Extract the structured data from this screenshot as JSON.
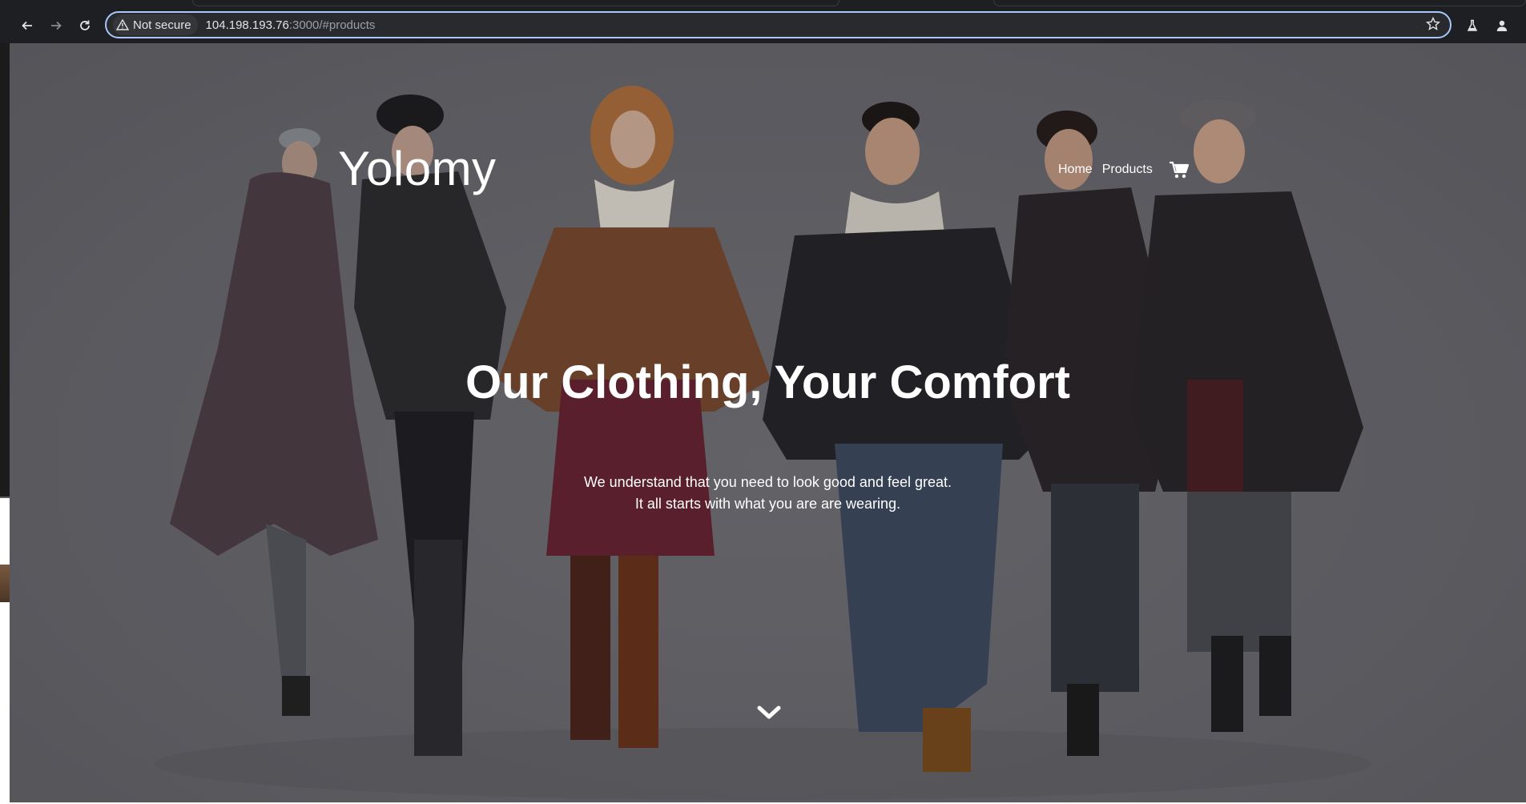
{
  "browser": {
    "security_label": "Not secure",
    "url_host": "104.198.193.76",
    "url_rest": ":3000/#products",
    "icons": [
      "back-icon",
      "forward-icon",
      "reload-icon",
      "warning-icon",
      "star-icon",
      "labs-flask-icon",
      "profile-icon"
    ]
  },
  "site": {
    "brand": "Yolomy",
    "nav": {
      "home": "Home",
      "products": "Products"
    },
    "hero_title": "Our Clothing, Your Comfort",
    "hero_line1": "We understand that you need to look good and feel great.",
    "hero_line2": "It all starts with what you are are wearing.",
    "icons": [
      "cart-icon",
      "chevron-down-icon"
    ]
  }
}
